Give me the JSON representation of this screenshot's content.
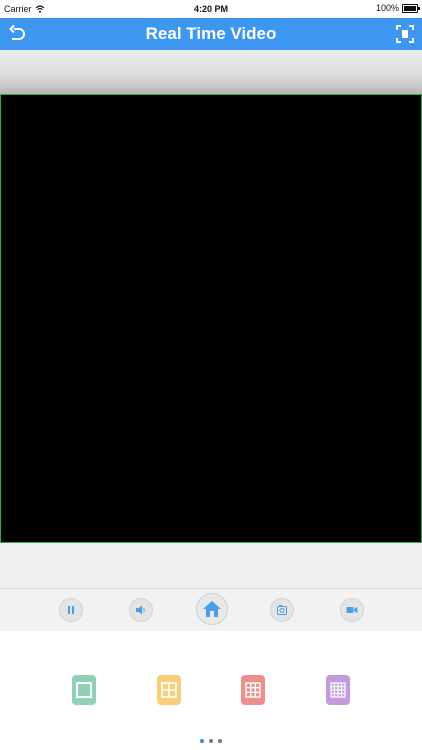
{
  "status_bar": {
    "carrier": "Carrier",
    "time": "4:20 PM",
    "battery": "100%"
  },
  "nav": {
    "title": "Real Time Video",
    "back_icon": "undo-arrow-icon",
    "fullscreen_icon": "fullscreen-icon"
  },
  "controls": [
    {
      "name": "pause",
      "icon": "pause-icon"
    },
    {
      "name": "volume",
      "icon": "speaker-icon"
    },
    {
      "name": "home",
      "icon": "home-icon"
    },
    {
      "name": "snapshot",
      "icon": "camera-icon"
    },
    {
      "name": "record",
      "icon": "video-camera-icon"
    }
  ],
  "layouts": [
    {
      "name": "single-view",
      "grid": 1,
      "color": "#8fd0b6"
    },
    {
      "name": "quad-view",
      "grid": 2,
      "color": "#f7cf7a"
    },
    {
      "name": "nine-view",
      "grid": 3,
      "color": "#ef8f8c"
    },
    {
      "name": "sixteen-view",
      "grid": 4,
      "color": "#c39bdc"
    }
  ],
  "pagination": {
    "count": 3,
    "active": 0
  },
  "colors": {
    "nav_blue": "#3d96ef",
    "control_icon": "#4a9fe8",
    "video_border": "#34a853"
  }
}
